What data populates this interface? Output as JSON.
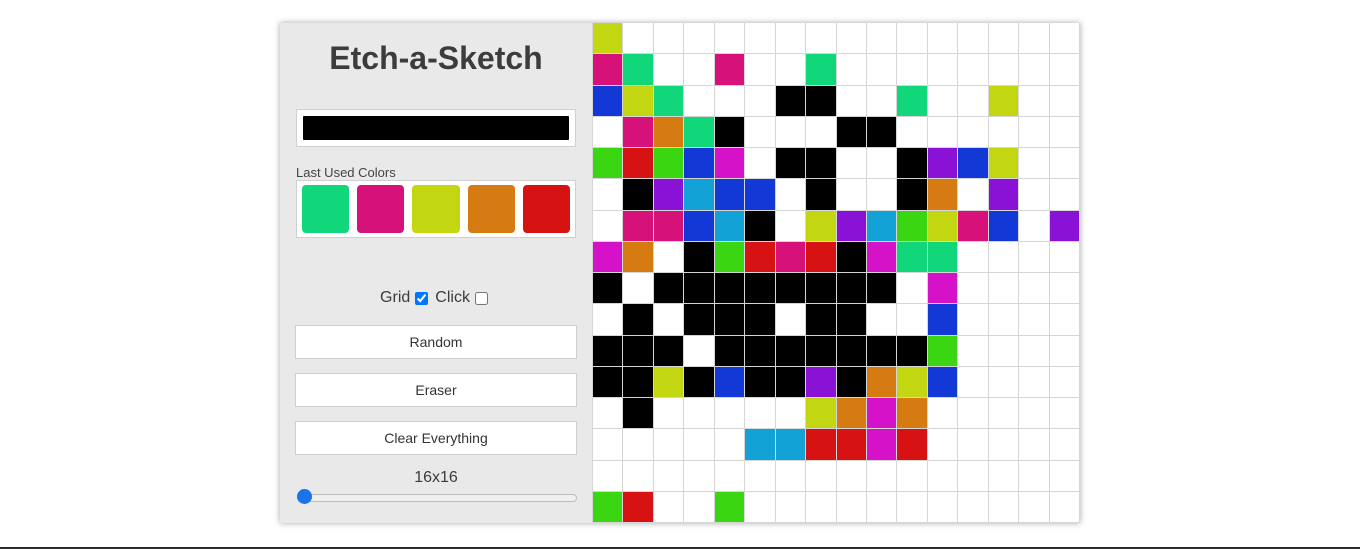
{
  "title": "Etch-a-Sketch",
  "current_color": "#000000",
  "last_used": {
    "label": "Last Used Colors",
    "colors": [
      "#12d67a",
      "#d6127a",
      "#c2d612",
      "#d67a12",
      "#d61212"
    ]
  },
  "toggles": {
    "grid_label": "Grid",
    "grid_checked": true,
    "click_label": "Click",
    "click_checked": false
  },
  "buttons": {
    "random": "Random",
    "eraser": "Eraser",
    "clear": "Clear Everything"
  },
  "size": {
    "label": "16x16",
    "value": 16
  },
  "palette": {
    "W": "#ffffff",
    "K": "#000000",
    "G": "#12d67a",
    "M": "#d6127a",
    "Y": "#c2d612",
    "O": "#d67a12",
    "R": "#d61212",
    "B": "#1238d6",
    "L": "#3ad612",
    "P": "#d612c8",
    "V": "#8a12d6",
    "C": "#12a2d6"
  },
  "grid_rows": [
    "YWWWWWWWWWWWWWWW",
    "MGWWMWWGWWWWWWWW",
    "BYGWWWKKWWGWWYWW",
    "WMOGKWWWKKWWWWWW",
    "LRLBPWKKWWKVBYWW",
    "WKVCBBWKWWKOWVWW",
    "WMMBCKWYVCLYMBWV",
    "POWKLRMRKPGGWWWW",
    "KWKKKKKKKKWPWWWW",
    "WKWKKKWKKWWBWWWW",
    "KKKWKKKKKKKLWWWW",
    "KKYKBKKVKOYBWWWW",
    "WKWWWWWYOPOWWWWW",
    "WWWWWCCRRPRWWWWW",
    "WWWWWWWWWWWWWWWW",
    "LRWWLWWWWWWWWWWW"
  ]
}
